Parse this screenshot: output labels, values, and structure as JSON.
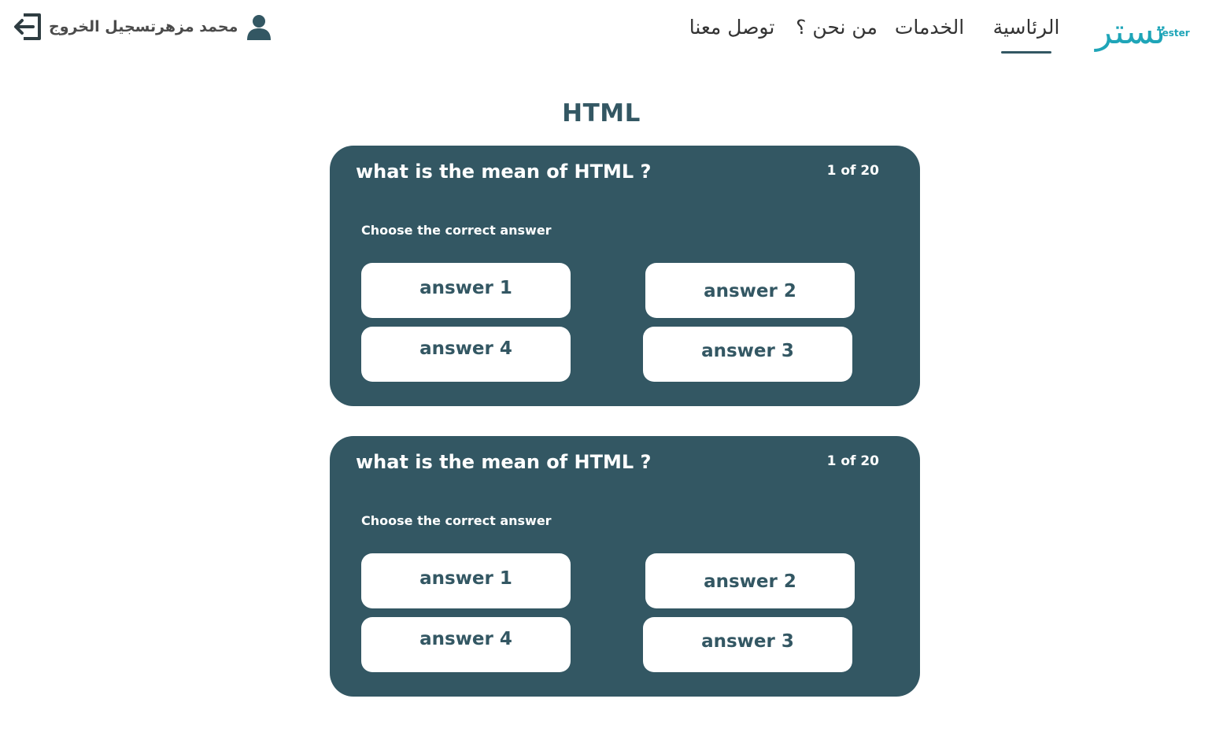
{
  "header": {
    "logout_label": "تسجيل الخروج",
    "user_name": "محمد مزهر",
    "nav": {
      "home": "الرئاسية",
      "services": "الخدمات",
      "about": "من نحن ؟",
      "contact": "توصل معنا"
    },
    "logo": {
      "arabic": "تستر",
      "english": "Tester"
    }
  },
  "page_title": "HTML",
  "quiz_cards": [
    {
      "question": "what is the mean of HTML ?",
      "counter": "1 of 20",
      "instruction": "Choose the correct answer",
      "answers": [
        "answer 1",
        "answer 2",
        "answer 3",
        "answer 4"
      ]
    },
    {
      "question": "what is the mean of HTML ?",
      "counter": "1 of 20",
      "instruction": "Choose the correct answer",
      "answers": [
        "answer 1",
        "answer 2",
        "answer 3",
        "answer 4"
      ]
    }
  ],
  "colors": {
    "primary": "#335763",
    "logo": "#1fa5b8",
    "nav_text": "#333333",
    "background": "#ffffff"
  },
  "icons": {
    "logout": "logout-arrow-icon",
    "user": "user-avatar-icon"
  }
}
